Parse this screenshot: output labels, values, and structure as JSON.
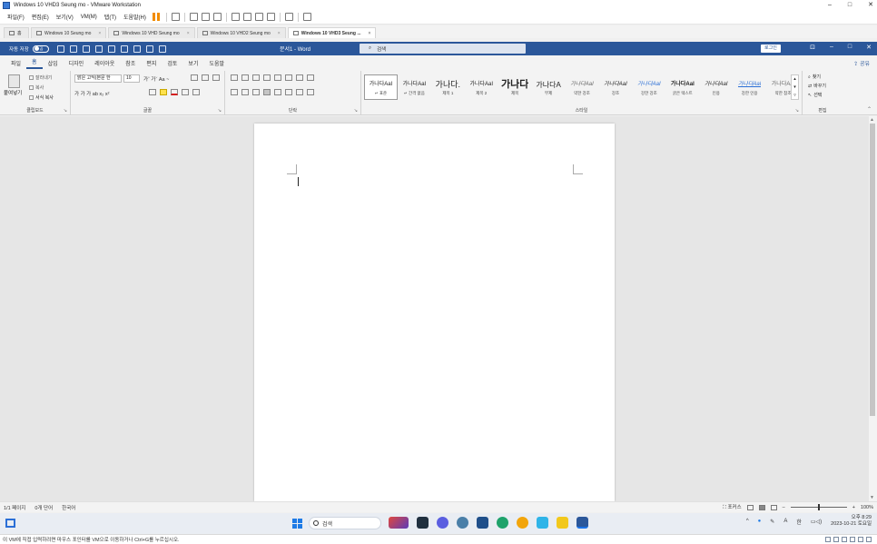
{
  "vmware": {
    "window_title": "Windows 10 VHD3 Seung mo - VMware Workstation",
    "window_controls": [
      "–",
      "□",
      "✕"
    ],
    "menu": [
      "파일(F)",
      "편집(E)",
      "보기(V)",
      "VM(M)",
      "탭(T)",
      "도움말(H)"
    ],
    "tabs": [
      {
        "label": "홈"
      },
      {
        "label": "Windows 10 Seung mo"
      },
      {
        "label": "Windows 10 VHD Seung mo"
      },
      {
        "label": "Windows 10 VHD2 Seung mo"
      },
      {
        "label": "Windows 10 VHD3 Seung ..."
      }
    ],
    "tab_close": "×",
    "status_message": "이 VM에 직접 입력하려면 마우스 포인터를 VM으로 이동하거나 Ctrl+G를 누르십시오."
  },
  "word": {
    "autosave_label": "자동 저장",
    "autosave_state": "끔",
    "doc_name": "문서1 - Word",
    "search_placeholder": "검색",
    "login_label": "로그인",
    "window_controls": [
      "⊡",
      "–",
      "□",
      "✕"
    ],
    "ribbon_tabs": [
      "파일",
      "홈",
      "삽입",
      "디자인",
      "레이아웃",
      "참조",
      "편지",
      "검토",
      "보기",
      "도움말"
    ],
    "share_label": "공유",
    "clipboard": {
      "paste": "붙여넣기",
      "cut": "잘라내기",
      "copy": "복사",
      "format_painter": "서식 복사",
      "group": "클립보드"
    },
    "font": {
      "name": "맑은 고딕(본문 한",
      "size": "10",
      "row1_extra": "가ˆ 가ˇ  Aa ~",
      "row2": "가  가  가  ab  x₂  x²",
      "group": "글꼴"
    },
    "paragraph": {
      "group": "단락"
    },
    "styles": {
      "items": [
        {
          "preview": "가나다AaI",
          "name": "↵ 표준"
        },
        {
          "preview": "가나다AaI",
          "name": "↵ 간격 없음"
        },
        {
          "preview": "가나다.",
          "name": "제목 1"
        },
        {
          "preview": "가나다AaI",
          "name": "제목 2"
        },
        {
          "preview": "가나다",
          "name": "제목"
        },
        {
          "preview": "가나다A",
          "name": "부제"
        },
        {
          "preview": "가나다AaI",
          "name": "약한 강조"
        },
        {
          "preview": "가나다AaI",
          "name": "강조"
        },
        {
          "preview": "가나다AaI",
          "name": "강한 강조"
        },
        {
          "preview": "가나다AaI",
          "name": "굵은 텍스트"
        },
        {
          "preview": "가나다AaI",
          "name": "인용"
        },
        {
          "preview": "가나다AaI",
          "name": "강한 인용"
        },
        {
          "preview": "가나다AaI",
          "name": "약한 참조"
        }
      ],
      "group": "스타일"
    },
    "editing": {
      "find": "찾기",
      "replace": "바꾸기",
      "select": "선택",
      "group": "편집"
    },
    "statusbar": {
      "page": "1/1 페이지",
      "words": "0개 단어",
      "language": "한국어",
      "focus": "포커스",
      "zoom": "100%",
      "zoom_minus": "–",
      "zoom_plus": "+"
    }
  },
  "taskbar": {
    "search_placeholder": "검색",
    "tray_lang": "A",
    "tray_ime": "한",
    "time": "오후 8:29",
    "date": "2023-10-21 토요일"
  },
  "colors": {
    "word_blue": "#2b579a",
    "vmware_pause": "#f28c00"
  }
}
